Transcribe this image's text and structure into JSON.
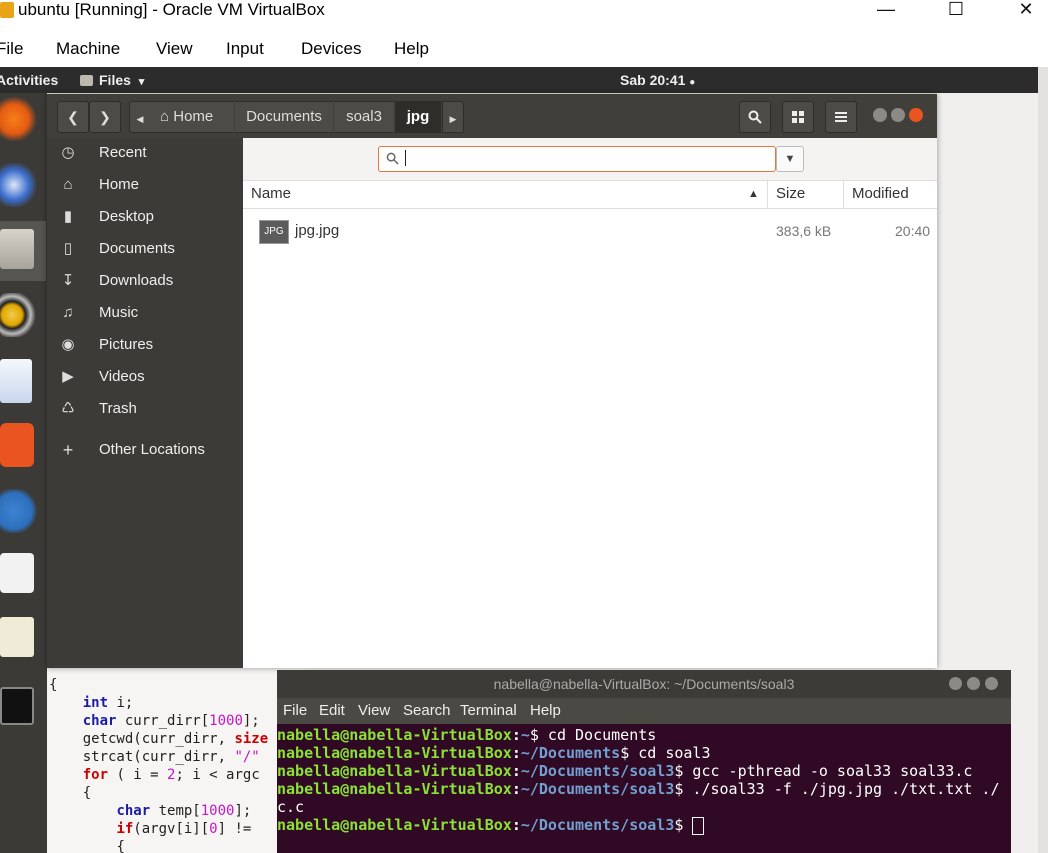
{
  "host": {
    "title": "ubuntu [Running] - Oracle VM VirtualBox",
    "controls": {
      "minimize": "—",
      "maximize": "☐",
      "close": "✕"
    },
    "menu": [
      "File",
      "Machine",
      "View",
      "Input",
      "Devices",
      "Help"
    ]
  },
  "topbar": {
    "activities": "Activities",
    "app": "Files",
    "app_arrow": "▾",
    "clock": "Sab 20:41",
    "clock_dot": "●"
  },
  "files": {
    "breadcrumbs": [
      "Home",
      "Documents",
      "soal3",
      "jpg"
    ],
    "sidebar": [
      {
        "label": "Recent",
        "icon": "clock-icon"
      },
      {
        "label": "Home",
        "icon": "home-icon"
      },
      {
        "label": "Desktop",
        "icon": "folder-icon"
      },
      {
        "label": "Documents",
        "icon": "document-icon"
      },
      {
        "label": "Downloads",
        "icon": "download-icon"
      },
      {
        "label": "Music",
        "icon": "music-icon"
      },
      {
        "label": "Pictures",
        "icon": "camera-icon"
      },
      {
        "label": "Videos",
        "icon": "video-icon"
      },
      {
        "label": "Trash",
        "icon": "trash-icon"
      },
      {
        "label": "Other Locations",
        "icon": "plus-icon"
      }
    ],
    "search_value": "",
    "columns": {
      "name": "Name",
      "size": "Size",
      "modified": "Modified"
    },
    "rows": [
      {
        "badge": "JPG",
        "name": "jpg.jpg",
        "size": "383,6 kB",
        "modified": "20:40"
      }
    ]
  },
  "editor": {
    "l1": "{",
    "l2a": "int",
    "l2b": " i;",
    "l3a": "char",
    "l3b": " curr_dirr[",
    "l3c": "1000",
    "l3d": "];",
    "l4a": "getcwd(curr_dirr, ",
    "l4b": "size",
    "l5a": "strcat(curr_dirr, ",
    "l5b": "\"/\"",
    "l6a": "for",
    "l6b": " ( i = ",
    "l6c": "2",
    "l6d": "; i < argc",
    "l7": "{",
    "l8a": "char",
    "l8b": " temp[",
    "l8c": "1000",
    "l8d": "];",
    "l9a": "if",
    "l9b": "(argv[i][",
    "l9c": "0",
    "l9d": "] !=",
    "l10": "{"
  },
  "terminal": {
    "title": "nabella@nabella-VirtualBox: ~/Documents/soal3",
    "menu": [
      "File",
      "Edit",
      "View",
      "Search",
      "Terminal",
      "Help"
    ],
    "user": "nabella@nabella-VirtualBox",
    "lines": [
      {
        "path": "~",
        "cmd": "$ cd Documents"
      },
      {
        "path": "~/Documents",
        "cmd": "$ cd soal3"
      },
      {
        "path": "~/Documents/soal3",
        "cmd": "$ gcc -pthread -o soal33 soal33.c"
      },
      {
        "path": "~/Documents/soal3",
        "cmd": "$ ./soal33 -f ./jpg.jpg ./txt.txt ./"
      }
    ],
    "wrap": "c.c",
    "prompt_path": "~/Documents/soal3",
    "prompt_cmd": "$ "
  }
}
